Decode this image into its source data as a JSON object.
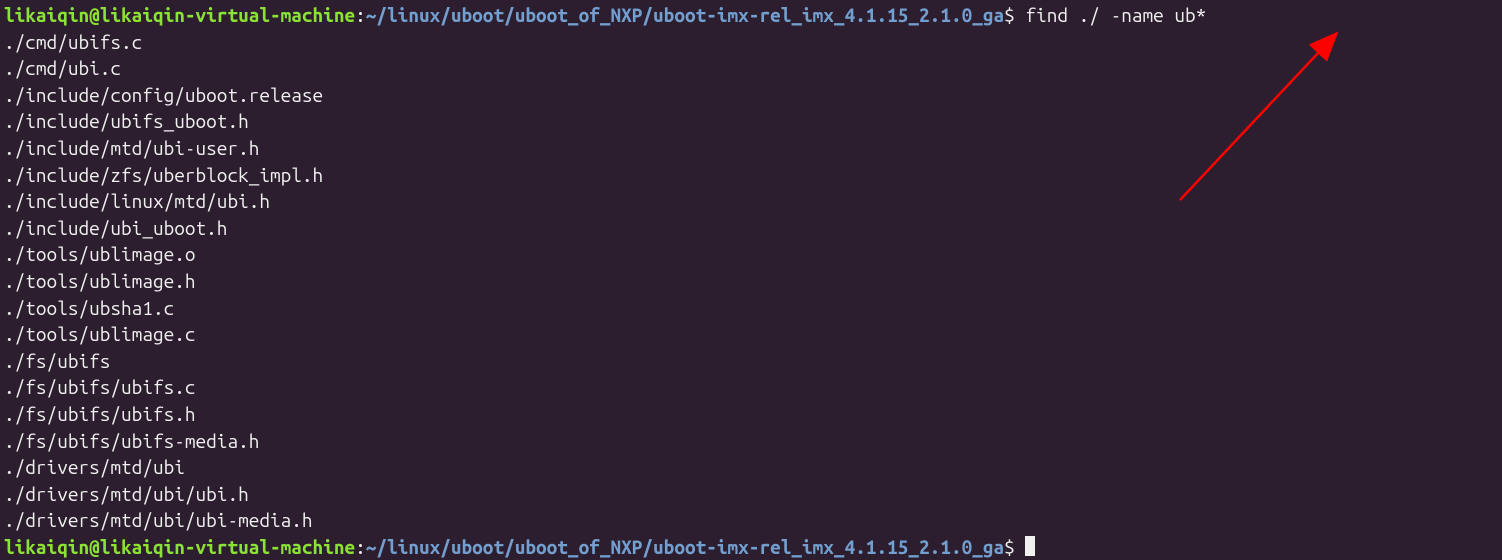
{
  "prompt": {
    "user_host": "likaiqin@likaiqin-virtual-machine",
    "colon": ":",
    "path": "~/linux/uboot/uboot_of_NXP/uboot-imx-rel_imx_4.1.15_2.1.0_ga",
    "dollar": "$"
  },
  "command": "find ./ -name ub*",
  "output_lines": [
    "./cmd/ubifs.c",
    "./cmd/ubi.c",
    "./include/config/uboot.release",
    "./include/ubifs_uboot.h",
    "./include/mtd/ubi-user.h",
    "./include/zfs/uberblock_impl.h",
    "./include/linux/mtd/ubi.h",
    "./include/ubi_uboot.h",
    "./tools/ublimage.o",
    "./tools/ublimage.h",
    "./tools/ubsha1.c",
    "./tools/ublimage.c",
    "./fs/ubifs",
    "./fs/ubifs/ubifs.c",
    "./fs/ubifs/ubifs.h",
    "./fs/ubifs/ubifs-media.h",
    "./drivers/mtd/ubi",
    "./drivers/mtd/ubi/ubi.h",
    "./drivers/mtd/ubi/ubi-media.h"
  ],
  "annotation": {
    "arrow_color": "#ff0000"
  }
}
